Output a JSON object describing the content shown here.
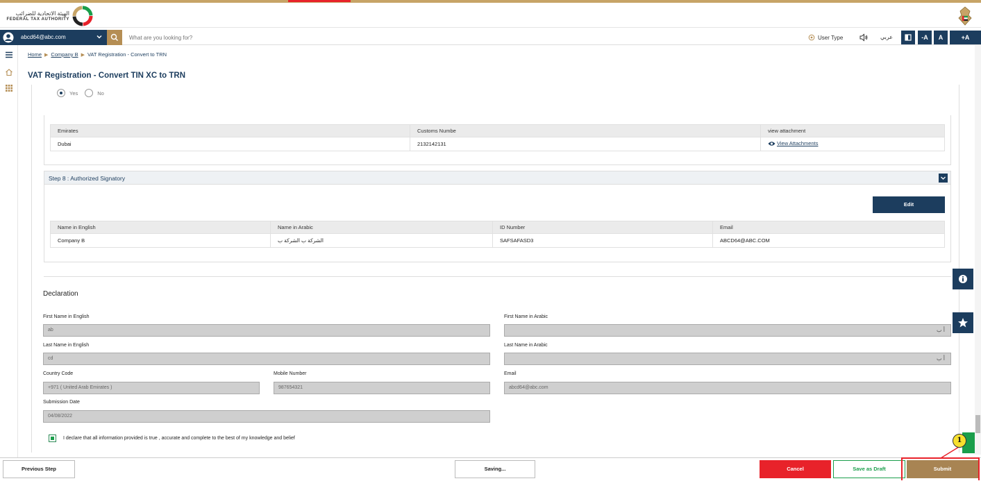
{
  "header": {
    "org_name_ar": "الهيئة الاتحادية للضرائب",
    "org_name_en": "FEDERAL TAX AUTHORITY"
  },
  "toolbar": {
    "user_email": "abcd64@abc.com",
    "search_placeholder": "What are you looking for?",
    "user_type_label": "User Type",
    "arabic_label": "عربي",
    "font_small": "-A",
    "font_normal": "A",
    "font_large": "+A"
  },
  "breadcrumb": {
    "home": "Home",
    "company": "Company B",
    "current": "VAT Registration - Convert to TRN"
  },
  "page": {
    "title": "VAT Registration - Convert TIN XC to TRN"
  },
  "radio": {
    "yes": "Yes",
    "no": "No"
  },
  "customs_table": {
    "headers": [
      "Emirates",
      "Customs Numbe",
      "view attachment"
    ],
    "row": {
      "emirate": "Dubai",
      "customs_number": "2132142131",
      "attachment_link": "View Attachments"
    }
  },
  "step8": {
    "title": "Step 8 : Authorized Signatory",
    "edit_label": "Edit",
    "headers": [
      "Name in English",
      "Name in Arabic",
      "ID Number",
      "Email"
    ],
    "row": {
      "name_en": "Company B",
      "name_ar": "الشركة ب الشركة ب",
      "id_number": "SAFSAFASD3",
      "email": "ABCD64@ABC.COM"
    }
  },
  "declaration": {
    "title": "Declaration",
    "first_name_en_label": "First Name in English",
    "first_name_en_value": "ab",
    "first_name_ar_label": "First Name in Arabic",
    "first_name_ar_hint": "أ ب",
    "last_name_en_label": "Last Name in English",
    "last_name_en_value": "cd",
    "last_name_ar_label": "Last Name in Arabic",
    "last_name_ar_hint": "أ ب",
    "country_code_label": "Country Code",
    "country_code_value": "+971 ( United Arab Emirates )",
    "mobile_label": "Mobile Number",
    "mobile_value": "987654321",
    "email_label": "Email",
    "email_value": "abcd64@abc.com",
    "submission_date_label": "Submission Date",
    "submission_date_value": "04/08/2022",
    "declare_text": "I declare that all information provided is true , accurate and complete to the best of my knowledge and belief"
  },
  "footer": {
    "previous": "Previous Step",
    "saving": "Saving...",
    "cancel": "Cancel",
    "save_draft": "Save as Draft",
    "submit": "Submit"
  },
  "annotation": {
    "callout_number": "1"
  },
  "colors": {
    "navy": "#1c3d5e",
    "gold": "#a88453",
    "red": "#e8222a",
    "green": "#1a9e4b"
  }
}
